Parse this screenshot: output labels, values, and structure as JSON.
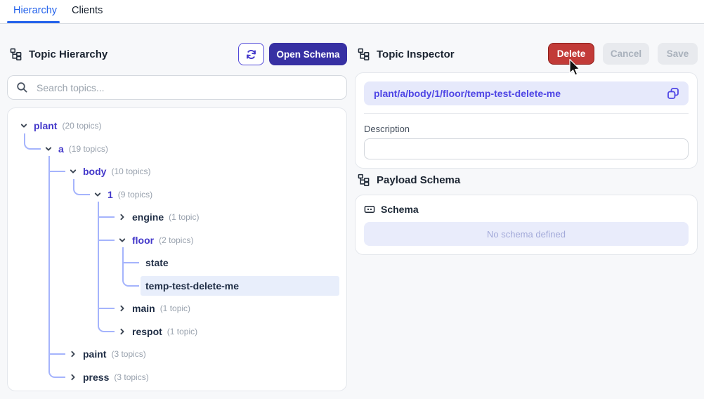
{
  "tabs": [
    {
      "label": "Hierarchy",
      "active": true
    },
    {
      "label": "Clients",
      "active": false
    }
  ],
  "left_panel": {
    "title": "Topic Hierarchy",
    "open_schema_label": "Open Schema",
    "search_placeholder": "Search topics...",
    "tree": [
      {
        "label": "plant",
        "count": "(20 topics)",
        "chevron": "down",
        "expanded": true,
        "children": [
          {
            "label": "a",
            "count": "(19 topics)",
            "chevron": "down",
            "expanded": true,
            "children": [
              {
                "label": "body",
                "count": "(10 topics)",
                "chevron": "down",
                "expanded": true,
                "children": [
                  {
                    "label": "1",
                    "count": "(9 topics)",
                    "chevron": "down",
                    "expanded": true,
                    "children": [
                      {
                        "label": "engine",
                        "count": "(1 topic)",
                        "chevron": "right"
                      },
                      {
                        "label": "floor",
                        "count": "(2 topics)",
                        "chevron": "down",
                        "expanded": true,
                        "children": [
                          {
                            "label": "state",
                            "chevron": "none"
                          },
                          {
                            "label": "temp-test-delete-me",
                            "chevron": "none",
                            "selected": true
                          }
                        ]
                      },
                      {
                        "label": "main",
                        "count": "(1 topic)",
                        "chevron": "right"
                      },
                      {
                        "label": "respot",
                        "count": "(1 topic)",
                        "chevron": "right"
                      }
                    ]
                  }
                ]
              },
              {
                "label": "paint",
                "count": "(3 topics)",
                "chevron": "right"
              },
              {
                "label": "press",
                "count": "(3 topics)",
                "chevron": "right"
              }
            ]
          }
        ]
      }
    ]
  },
  "right_panel": {
    "title": "Topic Inspector",
    "buttons": {
      "delete": "Delete",
      "cancel": "Cancel",
      "save": "Save"
    },
    "topic_path": "plant/a/body/1/floor/temp-test-delete-me",
    "description_label": "Description",
    "description_value": "",
    "payload_schema_title": "Payload Schema",
    "schema_label": "Schema",
    "no_schema_text": "No schema defined"
  },
  "colors": {
    "tab_active_blue": "#2563eb",
    "accent_indigo": "#4338ca",
    "path_indigo": "#4f46e5",
    "open_schema_bg": "#3730a3",
    "delete_red": "#c23b38",
    "tree_line": "#a5b4fc",
    "selected_row_bg": "#e8eefb",
    "pill_bg": "#e6e9fb",
    "noschema_bg": "#e9ecfb"
  }
}
